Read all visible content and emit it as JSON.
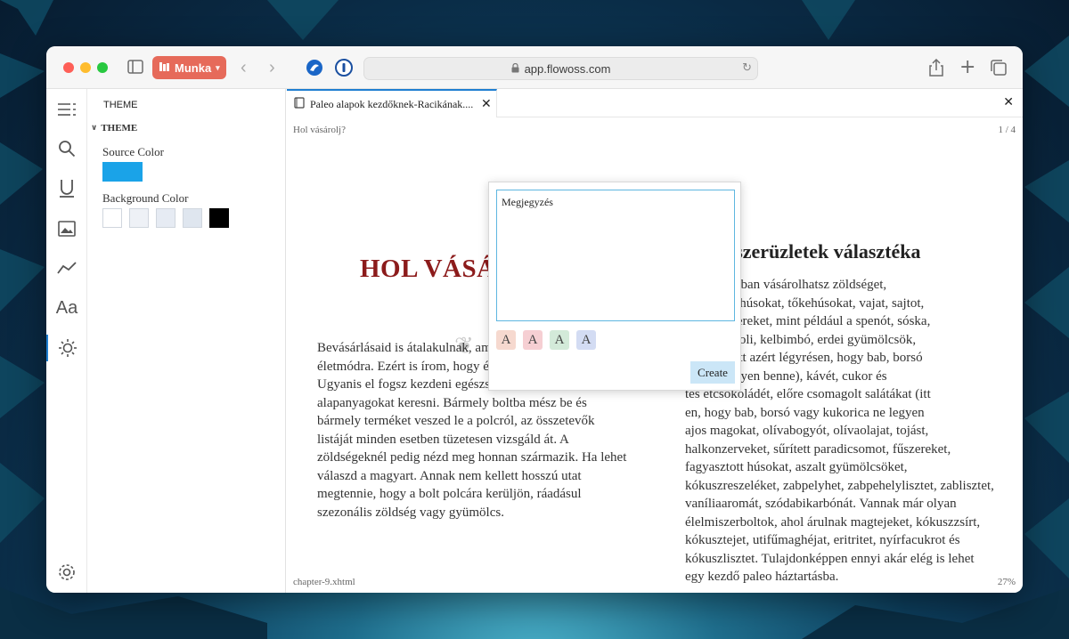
{
  "browser": {
    "profile_label": "Munka",
    "url": "app.flowoss.com"
  },
  "sidebar": {
    "header": "THEME",
    "section_title": "THEME",
    "source_color_label": "Source Color",
    "source_color": "#1aa3e8",
    "background_color_label": "Background Color",
    "background_colors": [
      "#ffffff",
      "#eef1f6",
      "#e6ebf3",
      "#dfe6ef",
      "#000000"
    ]
  },
  "reader": {
    "tab_title": "Paleo alapok kezdőknek-Racikának....",
    "section_name": "Hol vásárolj?",
    "page_indicator": "1 / 4",
    "chapter_file": "chapter-9.xhtml",
    "progress": "27%",
    "chapter_title": "HOL VÁSÁ",
    "left_column": [
      "Bevásárlásaid is átalakulnak, am",
      "életmódra. Ezért is írom, hogy él",
      "Ugyanis el fogsz kezdeni egészsé",
      "alapanyagokat keresni. Bármely boltba mész be és",
      "bármely terméket veszed le a polcról, az összetevők",
      "listáját minden esetben tüzetesen vizsgáld át. A",
      "zöldségeknél pedig nézd meg honnan származik. Ha lehet",
      "válaszd a magyart. Annak nem kellett hosszú utat",
      "megtennie, hogy a bolt polcára kerüljön, ráadásul",
      "szezonális zöldség vagy gyümölcs."
    ],
    "right_heading": "élelmiszerüzletek választéka",
    "right_column": [
      "szerboltokban vásárolhatsz zöldséget,",
      "ot, füstölt húsokat, tőkehúsokat, vajat, sajtot,",
      "t élelmiszereket, mint például a spenót, sóska,",
      "lva, brokkoli, kelbimbó, erdei gyümölcsök,",
      "verékek (itt azért légyrésen, hogy bab, borsó",
      "rica ne legyen benne), kávét, cukor és",
      "tes étcsokoládét, előre csomagolt salátákat (itt",
      "en, hogy bab, borsó vagy kukorica ne legyen",
      "ajos magokat, olívabogyót, olívaolajat, tojást,",
      "halkonzerveket, sűrített paradicsomot, fűszereket,",
      "fagyasztott húsokat, aszalt gyümölcsöket,",
      "kókuszreszeléket, zabpelyhet, zabpehelylisztet, zablisztet,",
      "vaníliaaromát, szódabikarbónát. Vannak már olyan",
      "élelmiszerboltok, ahol árulnak magtejeket, kókuszzsírt,",
      "kókusztejet, utifűmaghéjat, eritritet, nyírfacukrot és",
      "kókuszlisztet. Tulajdonképpen ennyi akár elég is lehet",
      "egy kezdő paleo háztartásba."
    ]
  },
  "note_popup": {
    "text": "Megjegyzés",
    "color_letter": "A",
    "highlight_colors": [
      "#f6d9cf",
      "#f6cfd3",
      "#d3ead9",
      "#d3dcf3"
    ],
    "create_label": "Create"
  }
}
